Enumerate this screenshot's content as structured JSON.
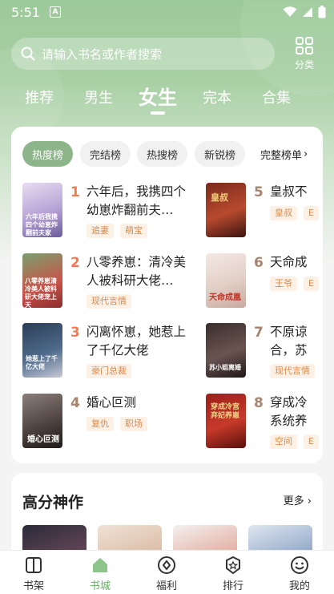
{
  "status_bar": {
    "time": "5:51",
    "note_icon_letter": "A"
  },
  "search": {
    "placeholder": "请输入书名或作者搜索"
  },
  "category": {
    "label": "分类"
  },
  "tabs": [
    {
      "label": "推荐"
    },
    {
      "label": "男生"
    },
    {
      "label": "女生"
    },
    {
      "label": "完本"
    },
    {
      "label": "合集"
    }
  ],
  "active_tab": "女生",
  "ranking": {
    "chips": [
      {
        "label": "热度榜"
      },
      {
        "label": "完结榜"
      },
      {
        "label": "热搜榜"
      },
      {
        "label": "新锐榜"
      }
    ],
    "more_label": "完整榜单",
    "books": [
      {
        "rank": "1",
        "title": "六年后，我携四个幼崽炸翻前夫…",
        "tags": [
          "追妻",
          "萌宝"
        ],
        "cover_text": "六年后我携四个幼崽炸翻前夫家"
      },
      {
        "rank": "2",
        "title": "八零养崽：清冷美人被科研大佬…",
        "tags": [
          "现代言情"
        ],
        "cover_text": "八零养崽清冷美人被科研大佬宠上天"
      },
      {
        "rank": "3",
        "title": "闪离怀崽，她惹上了千亿大佬",
        "tags": [
          "豪门总裁"
        ],
        "cover_text": "她惹上了千亿大佬"
      },
      {
        "rank": "4",
        "title": "婚心叵测",
        "tags": [
          "复仇",
          "职场"
        ],
        "cover_text": "婚心叵测"
      },
      {
        "rank": "5",
        "title": "皇叔不",
        "tags": [
          "皇叔",
          "E"
        ],
        "cover_text": "皇叔"
      },
      {
        "rank": "6",
        "title": "天命成",
        "tags": [
          "王爷",
          "E"
        ],
        "cover_text": "天命成凰"
      },
      {
        "rank": "7",
        "title": "不原谅合，苏",
        "tags": [
          "现代言情"
        ],
        "cover_text": "苏小姐离婚"
      },
      {
        "rank": "8",
        "title": "穿成冷系统养",
        "tags": [
          "空间",
          "E"
        ],
        "cover_text": "穿成冷宫弃妃养崽"
      }
    ]
  },
  "high_score": {
    "title": "高分神作",
    "more_label": "更多"
  },
  "bottom_nav": [
    {
      "label": "书架",
      "icon": "book-open-icon"
    },
    {
      "label": "书城",
      "icon": "home-icon"
    },
    {
      "label": "福利",
      "icon": "gift-icon"
    },
    {
      "label": "排行",
      "icon": "trophy-icon"
    },
    {
      "label": "我的",
      "icon": "smile-icon"
    }
  ],
  "colors": {
    "accent": "#8db58a",
    "nav_active": "#6fae6c",
    "rank_top": "#f07b56",
    "rank_other": "#a6846e",
    "tag_bg": "#fdf1e6",
    "tag_text": "#d98a4e"
  }
}
